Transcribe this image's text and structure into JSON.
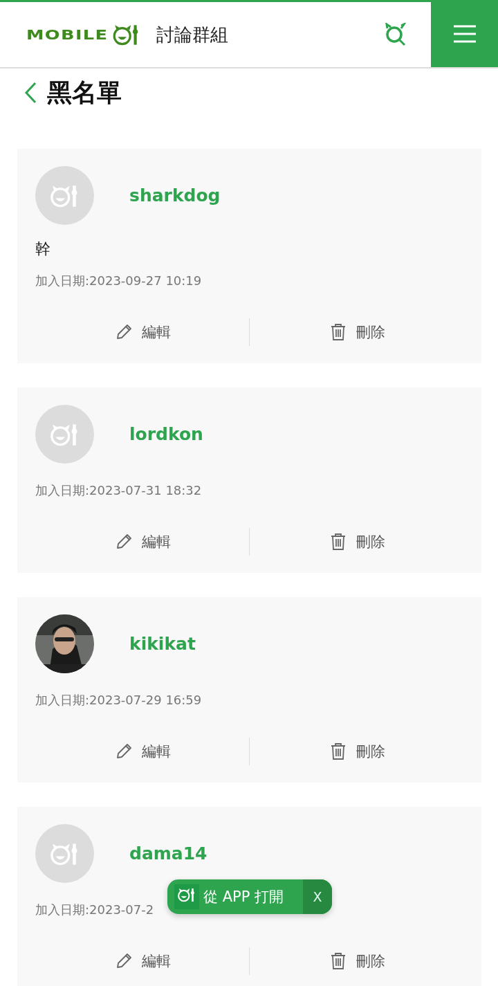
{
  "header": {
    "logo_text": "MOBILE",
    "section": "討論群組"
  },
  "page": {
    "title": "黑名單"
  },
  "entries": [
    {
      "username": "sharkdog",
      "avatar": {
        "kind": "default"
      },
      "note": "幹",
      "date": "加入日期:2023-09-27 10:19",
      "actions": [
        "編輯",
        "刪除"
      ]
    },
    {
      "username": "lordkon",
      "avatar": {
        "kind": "default"
      },
      "date": "加入日期:2023-07-31 18:32",
      "actions": [
        "編輯",
        "刪除"
      ]
    },
    {
      "username": "kikikat",
      "date": "加入日期:2023-07-29 16:59",
      "actions": [
        "編輯",
        "刪除"
      ]
    },
    {
      "username": "dama14",
      "avatar": {
        "kind": "default"
      },
      "date": "加入日期:2023-07-2",
      "actions": [
        "編輯",
        "刪除"
      ]
    }
  ],
  "open_app_toast": {
    "label": "從 APP 打開",
    "close": "X"
  }
}
